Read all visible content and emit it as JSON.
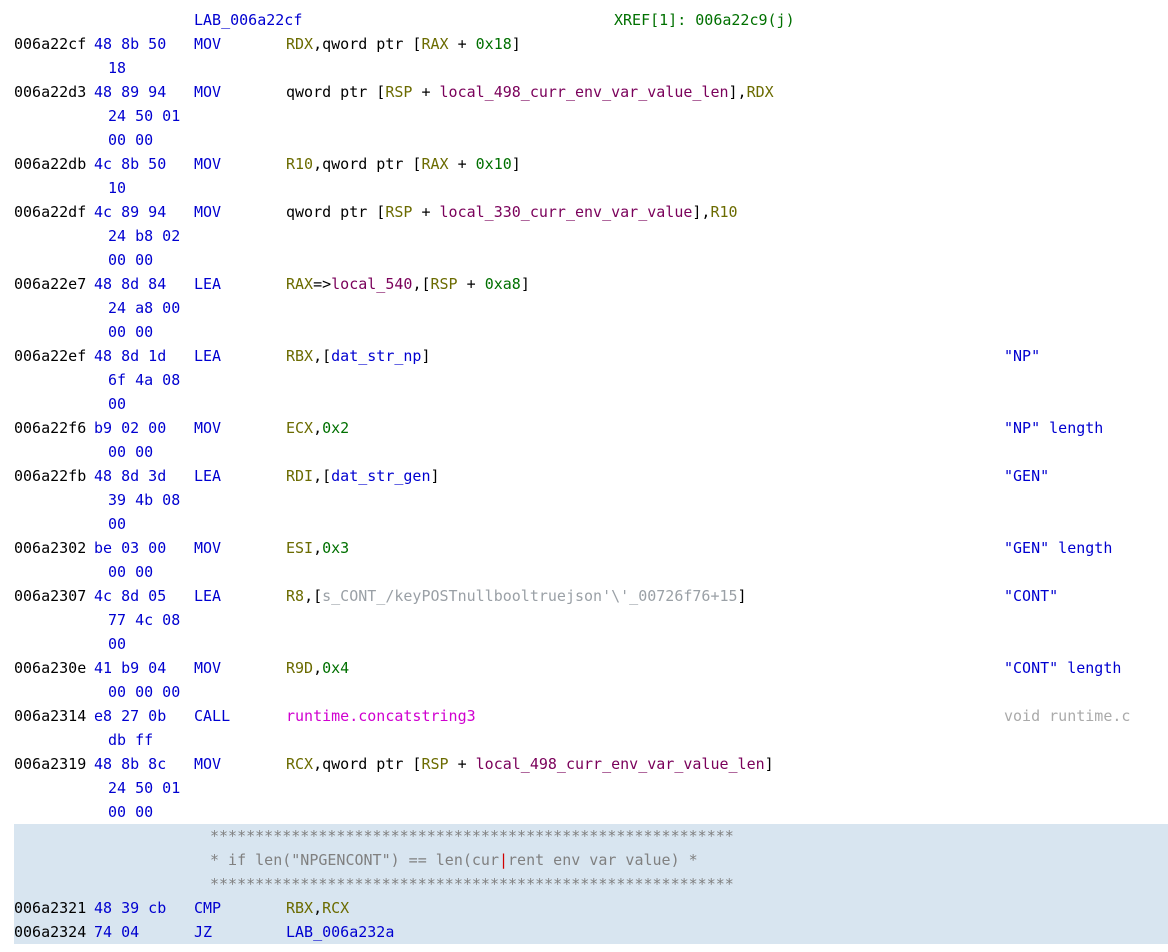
{
  "label_header": {
    "label": "LAB_006a22cf",
    "xref_tag": "XREF[1]:",
    "xref_loc": "006a22c9(j)"
  },
  "lines": [
    {
      "addr": "006a22cf",
      "bytes": [
        "48 8b 50",
        "18"
      ],
      "mnemonic": "MOV",
      "operands": [
        {
          "t": "reg",
          "v": "RDX"
        },
        {
          "t": "punct",
          "v": ",qword ptr ["
        },
        {
          "t": "reg",
          "v": "RAX"
        },
        {
          "t": "punct",
          "v": " + "
        },
        {
          "t": "lit",
          "v": "0x18"
        },
        {
          "t": "punct",
          "v": "]"
        }
      ]
    },
    {
      "addr": "006a22d3",
      "bytes": [
        "48 89 94",
        "24 50 01",
        "00 00"
      ],
      "mnemonic": "MOV",
      "operands": [
        {
          "t": "punct",
          "v": "qword ptr ["
        },
        {
          "t": "reg",
          "v": "RSP"
        },
        {
          "t": "punct",
          "v": " + "
        },
        {
          "t": "var",
          "v": "local_498_curr_env_var_value_len"
        },
        {
          "t": "punct",
          "v": "],"
        },
        {
          "t": "reg",
          "v": "RDX"
        }
      ]
    },
    {
      "addr": "006a22db",
      "bytes": [
        "4c 8b 50",
        "10"
      ],
      "mnemonic": "MOV",
      "operands": [
        {
          "t": "reg",
          "v": "R10"
        },
        {
          "t": "punct",
          "v": ",qword ptr ["
        },
        {
          "t": "reg",
          "v": "RAX"
        },
        {
          "t": "punct",
          "v": " + "
        },
        {
          "t": "lit",
          "v": "0x10"
        },
        {
          "t": "punct",
          "v": "]"
        }
      ]
    },
    {
      "addr": "006a22df",
      "bytes": [
        "4c 89 94",
        "24 b8 02",
        "00 00"
      ],
      "mnemonic": "MOV",
      "operands": [
        {
          "t": "punct",
          "v": "qword ptr ["
        },
        {
          "t": "reg",
          "v": "RSP"
        },
        {
          "t": "punct",
          "v": " + "
        },
        {
          "t": "var",
          "v": "local_330_curr_env_var_value"
        },
        {
          "t": "punct",
          "v": "],"
        },
        {
          "t": "reg",
          "v": "R10"
        }
      ]
    },
    {
      "addr": "006a22e7",
      "bytes": [
        "48 8d 84",
        "24 a8 00",
        "00 00"
      ],
      "mnemonic": "LEA",
      "operands": [
        {
          "t": "reg",
          "v": "RAX"
        },
        {
          "t": "punct",
          "v": "=>"
        },
        {
          "t": "var",
          "v": "local_540"
        },
        {
          "t": "punct",
          "v": ",["
        },
        {
          "t": "reg",
          "v": "RSP"
        },
        {
          "t": "punct",
          "v": " + "
        },
        {
          "t": "lit",
          "v": "0xa8"
        },
        {
          "t": "punct",
          "v": "]"
        }
      ]
    },
    {
      "addr": "006a22ef",
      "bytes": [
        "48 8d 1d",
        "6f 4a 08",
        "00"
      ],
      "mnemonic": "LEA",
      "operands": [
        {
          "t": "reg",
          "v": "RBX"
        },
        {
          "t": "punct",
          "v": ",["
        },
        {
          "t": "sym",
          "v": "dat_str_np"
        },
        {
          "t": "punct",
          "v": "]"
        }
      ],
      "comment": "\"NP\""
    },
    {
      "addr": "006a22f6",
      "bytes": [
        "b9 02 00",
        "00 00"
      ],
      "mnemonic": "MOV",
      "operands": [
        {
          "t": "reg",
          "v": "ECX"
        },
        {
          "t": "punct",
          "v": ","
        },
        {
          "t": "lit",
          "v": "0x2"
        }
      ],
      "comment": "\"NP\" length"
    },
    {
      "addr": "006a22fb",
      "bytes": [
        "48 8d 3d",
        "39 4b 08",
        "00"
      ],
      "mnemonic": "LEA",
      "operands": [
        {
          "t": "reg",
          "v": "RDI"
        },
        {
          "t": "punct",
          "v": ",["
        },
        {
          "t": "sym",
          "v": "dat_str_gen"
        },
        {
          "t": "punct",
          "v": "]"
        }
      ],
      "comment": "\"GEN\""
    },
    {
      "addr": "006a2302",
      "bytes": [
        "be 03 00",
        "00 00"
      ],
      "mnemonic": "MOV",
      "operands": [
        {
          "t": "reg",
          "v": "ESI"
        },
        {
          "t": "punct",
          "v": ","
        },
        {
          "t": "lit",
          "v": "0x3"
        }
      ],
      "comment": "\"GEN\" length"
    },
    {
      "addr": "006a2307",
      "bytes": [
        "4c 8d 05",
        "77 4c 08",
        "00"
      ],
      "mnemonic": "LEA",
      "operands": [
        {
          "t": "reg",
          "v": "R8"
        },
        {
          "t": "punct",
          "v": ",["
        },
        {
          "t": "syscomment",
          "v": "s_CONT_/keyPOSTnullbooltruejson'\\'_00726f76+15"
        },
        {
          "t": "punct",
          "v": "]"
        }
      ],
      "comment": "\"CONT\""
    },
    {
      "addr": "006a230e",
      "bytes": [
        "41 b9 04",
        "00 00 00"
      ],
      "mnemonic": "MOV",
      "operands": [
        {
          "t": "reg",
          "v": "R9D"
        },
        {
          "t": "punct",
          "v": ","
        },
        {
          "t": "lit",
          "v": "0x4"
        }
      ],
      "comment": "\"CONT\" length"
    },
    {
      "addr": "006a2314",
      "bytes": [
        "e8 27 0b",
        "db ff"
      ],
      "mnemonic": "CALL",
      "operands": [
        {
          "t": "func",
          "v": "runtime.concatstring3"
        }
      ],
      "comment_dim": "void runtime.c"
    },
    {
      "addr": "006a2319",
      "bytes": [
        "48 8b 8c",
        "24 50 01",
        "00 00"
      ],
      "mnemonic": "MOV",
      "operands": [
        {
          "t": "reg",
          "v": "RCX"
        },
        {
          "t": "punct",
          "v": ",qword ptr ["
        },
        {
          "t": "reg",
          "v": "RSP"
        },
        {
          "t": "punct",
          "v": " + "
        },
        {
          "t": "var",
          "v": "local_498_curr_env_var_value_len"
        },
        {
          "t": "punct",
          "v": "]"
        }
      ]
    }
  ],
  "comment_block": {
    "border": "**********************************************************",
    "text_left": "* if len(\"NPGENCONT\") == len(cur",
    "text_right": "rent env var value)         *"
  },
  "tail": [
    {
      "addr": "006a2321",
      "bytes": [
        "48 39 cb"
      ],
      "mnemonic": "CMP",
      "operands": [
        {
          "t": "reg",
          "v": "RBX"
        },
        {
          "t": "punct",
          "v": ","
        },
        {
          "t": "reg",
          "v": "RCX"
        }
      ]
    },
    {
      "addr": "006a2324",
      "bytes": [
        "74 04"
      ],
      "mnemonic": "JZ",
      "operands": [
        {
          "t": "label",
          "v": "LAB_006a232a"
        }
      ]
    }
  ]
}
